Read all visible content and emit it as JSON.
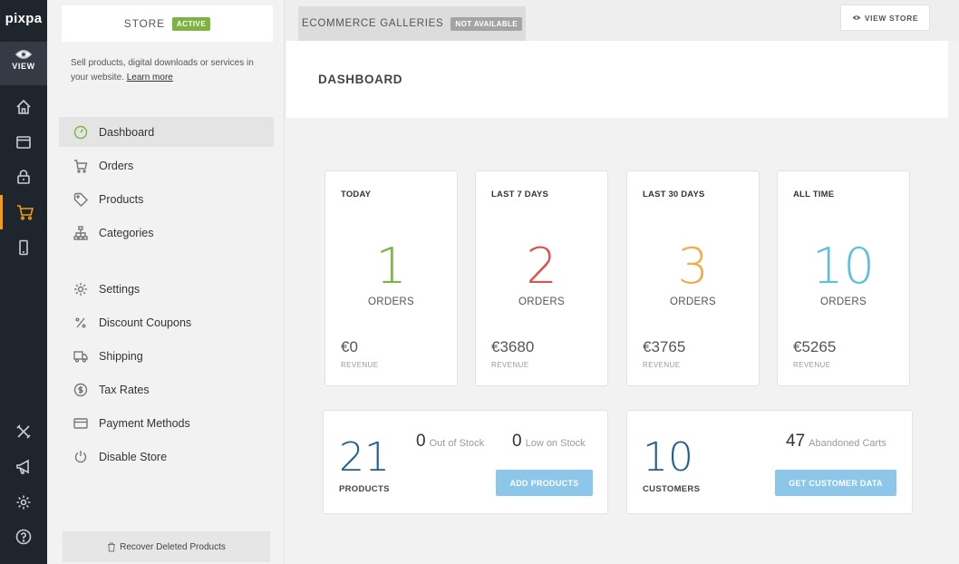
{
  "app": {
    "logo": "pixpa",
    "view_label": "VIEW"
  },
  "rail_icons": [
    "home-icon",
    "window-icon",
    "lock-icon",
    "cart-icon",
    "mobile-icon",
    "tools-icon",
    "megaphone-icon",
    "gear-icon",
    "help-icon"
  ],
  "sidebar": {
    "tab_label": "STORE",
    "tab_badge": "ACTIVE",
    "description": "Sell products, digital downloads or services in your website.",
    "learn_more": "Learn more",
    "items": [
      {
        "label": "Dashboard",
        "icon": "gauge-icon"
      },
      {
        "label": "Orders",
        "icon": "cart-icon"
      },
      {
        "label": "Products",
        "icon": "tag-icon"
      },
      {
        "label": "Categories",
        "icon": "sitemap-icon"
      },
      {
        "label": "Settings",
        "icon": "gear-icon"
      },
      {
        "label": "Discount Coupons",
        "icon": "percent-icon"
      },
      {
        "label": "Shipping",
        "icon": "truck-icon"
      },
      {
        "label": "Tax Rates",
        "icon": "dollar-icon"
      },
      {
        "label": "Payment Methods",
        "icon": "credit-card-icon"
      },
      {
        "label": "Disable Store",
        "icon": "power-icon"
      }
    ],
    "recover_label": "Recover Deleted Products"
  },
  "topbar": {
    "galleries_label": "ECOMMERCE GALLERIES",
    "galleries_badge": "NOT AVAILABLE",
    "view_store": "VIEW STORE"
  },
  "main": {
    "title": "DASHBOARD",
    "stats": [
      {
        "period": "TODAY",
        "orders": "1",
        "unit": "ORDERS",
        "revenue": "€0",
        "revenue_label": "REVENUE",
        "color": "#7cb342"
      },
      {
        "period": "LAST 7 DAYS",
        "orders": "2",
        "unit": "ORDERS",
        "revenue": "€3680",
        "revenue_label": "REVENUE",
        "color": "#d9534f"
      },
      {
        "period": "LAST 30 DAYS",
        "orders": "3",
        "unit": "ORDERS",
        "revenue": "€3765",
        "revenue_label": "REVENUE",
        "color": "#f0ad4e"
      },
      {
        "period": "ALL TIME",
        "orders": "10",
        "unit": "ORDERS",
        "revenue": "€5265",
        "revenue_label": "REVENUE",
        "color": "#5bc0de"
      }
    ],
    "products": {
      "count": "21",
      "label": "PRODUCTS",
      "out_of_stock": "0",
      "out_of_stock_label": "Out of Stock",
      "low_stock": "0",
      "low_stock_label": "Low on Stock",
      "button": "ADD PRODUCTS"
    },
    "customers": {
      "count": "10",
      "label": "CUSTOMERS",
      "abandoned": "47",
      "abandoned_label": "Abandoned Carts",
      "button": "GET CUSTOMER DATA"
    }
  }
}
